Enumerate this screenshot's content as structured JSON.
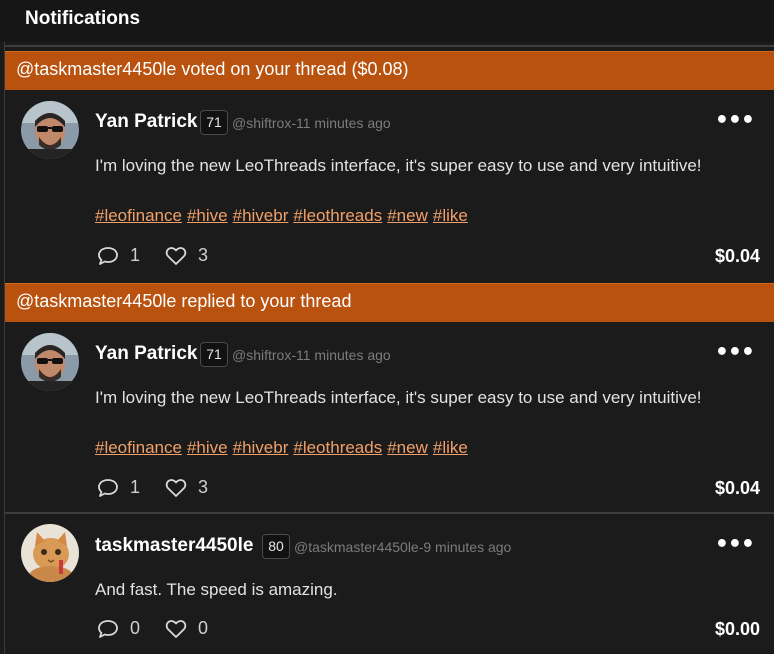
{
  "header": {
    "title": "Notifications"
  },
  "notifications": [
    {
      "banner": "@taskmaster4450le voted on your thread ($0.08)",
      "post": {
        "author": "Yan Patrick",
        "reputation": "71",
        "meta": "@shiftrox-11 minutes ago",
        "text": "I'm loving the new LeoThreads interface, it's super easy to use and very intuitive!",
        "tags": [
          "#leofinance",
          "#hive",
          "#hivebr",
          "#leothreads",
          "#new",
          "#like"
        ],
        "comments": "1",
        "likes": "3",
        "payout": "$0.04"
      }
    },
    {
      "banner": "@taskmaster4450le replied to your thread",
      "post": {
        "author": "Yan Patrick",
        "reputation": "71",
        "meta": "@shiftrox-11 minutes ago",
        "text": "I'm loving the new LeoThreads interface, it's super easy to use and very intuitive!",
        "tags": [
          "#leofinance",
          "#hive",
          "#hivebr",
          "#leothreads",
          "#new",
          "#like"
        ],
        "comments": "1",
        "likes": "3",
        "payout": "$0.04"
      },
      "reply": {
        "author": "taskmaster4450le",
        "reputation": "80",
        "meta": "@taskmaster4450le-9 minutes ago",
        "text": "And fast. The speed is amazing.",
        "comments": "0",
        "likes": "0",
        "payout": "$0.00"
      }
    }
  ],
  "icons": {
    "more": "more-options-icon",
    "comment": "comment-icon",
    "like": "heart-icon"
  },
  "colors": {
    "banner": "#b9520f",
    "tag": "#f0a067",
    "background": "#1b1b1c"
  }
}
